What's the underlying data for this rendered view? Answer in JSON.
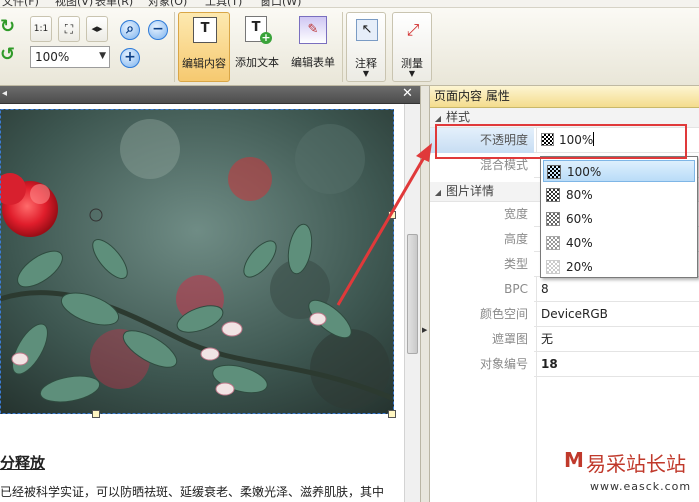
{
  "menubar": {
    "items": [
      "文件(F)",
      "视图(V)",
      "表单(R)",
      "对象(O)",
      "工具(T)",
      "窗口(W)"
    ]
  },
  "toolbar": {
    "zoom_value": "100%",
    "buttons": [
      {
        "label": "编辑内容",
        "icon": "edit-content-icon",
        "active": true
      },
      {
        "label": "添加文本",
        "icon": "add-text-icon",
        "active": false
      },
      {
        "label": "编辑表单",
        "icon": "edit-form-icon",
        "active": false
      },
      {
        "label": "注释",
        "icon": "annotation-icon",
        "active": false
      },
      {
        "label": "测量",
        "icon": "measure-icon",
        "active": false
      }
    ]
  },
  "document": {
    "heading": "分释放",
    "body_text": "已经被科学实证，可以防晒祛斑、延缓衰老、柔嫩光泽、滋养肌肤，其中"
  },
  "properties": {
    "title": "页面内容 属性",
    "section_style": "样式",
    "section_details": "图片详情",
    "rows": [
      {
        "label": "不透明度",
        "value": "100%"
      },
      {
        "label": "混合模式",
        "value": ""
      },
      {
        "label": "宽度",
        "value": ""
      },
      {
        "label": "高度",
        "value": ""
      },
      {
        "label": "类型",
        "value": ""
      },
      {
        "label": "BPC",
        "value": "8"
      },
      {
        "label": "颜色空间",
        "value": "DeviceRGB"
      },
      {
        "label": "遮罩图",
        "value": "无"
      },
      {
        "label": "对象编号",
        "value": "18"
      }
    ],
    "opacity_options": [
      "100%",
      "80%",
      "60%",
      "40%",
      "20%"
    ],
    "selected_option": "100%"
  },
  "watermark": {
    "text": "易采站长站",
    "url": "www.easck.com"
  },
  "colors": {
    "accent_red": "#e0393a",
    "selection_blue": "#b9dcf8",
    "header_gold": "#f4dc8d",
    "active_button": "#f6c970"
  }
}
